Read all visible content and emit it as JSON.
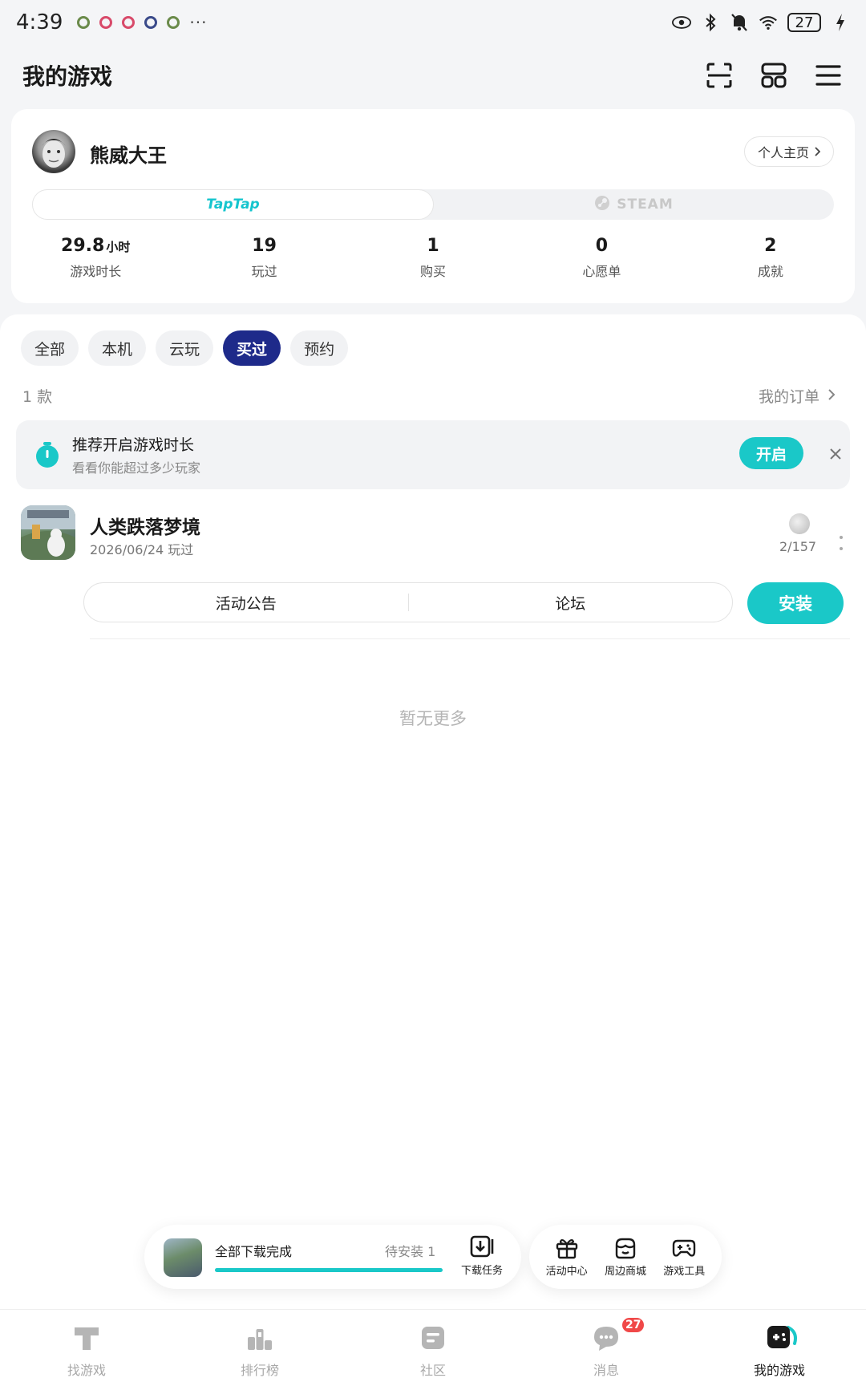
{
  "status_bar": {
    "time": "4:39",
    "more": "···",
    "battery": "27"
  },
  "header": {
    "title": "我的游戏"
  },
  "profile": {
    "username": "熊威大王",
    "homepage_label": "个人主页",
    "platforms": {
      "taptap": "TapTap",
      "steam": "STEAM"
    },
    "stats": [
      {
        "value": "29.8",
        "unit": "小时",
        "label": "游戏时长"
      },
      {
        "value": "19",
        "unit": "",
        "label": "玩过"
      },
      {
        "value": "1",
        "unit": "",
        "label": "购买"
      },
      {
        "value": "0",
        "unit": "",
        "label": "心愿单"
      },
      {
        "value": "2",
        "unit": "",
        "label": "成就"
      }
    ]
  },
  "filters": {
    "tabs": [
      "全部",
      "本机",
      "云玩",
      "买过",
      "预约"
    ],
    "active": "买过"
  },
  "list_meta": {
    "count": "1 款",
    "orders_label": "我的订单"
  },
  "reco_banner": {
    "title": "推荐开启游戏时长",
    "subtitle": "看看你能超过多少玩家",
    "open_label": "开启"
  },
  "game": {
    "title": "人类跌落梦境",
    "played": "2026/06/24 玩过",
    "achievements": "2/157",
    "actions": [
      "活动公告",
      "论坛"
    ],
    "install_label": "安装"
  },
  "empty_text": "暂无更多",
  "download_bar": {
    "title": "全部下载完成",
    "pending": "待安装 1",
    "progress": 1.0,
    "task_label": "下载任务"
  },
  "tools": [
    "活动中心",
    "周边商城",
    "游戏工具"
  ],
  "bottom_nav": {
    "items": [
      "找游戏",
      "排行榜",
      "社区",
      "消息",
      "我的游戏"
    ],
    "active": "我的游戏",
    "message_badge": "27"
  },
  "colors": {
    "accent": "#1ac8c8",
    "active_tab": "#1e2a8a",
    "badge": "#f04848"
  }
}
